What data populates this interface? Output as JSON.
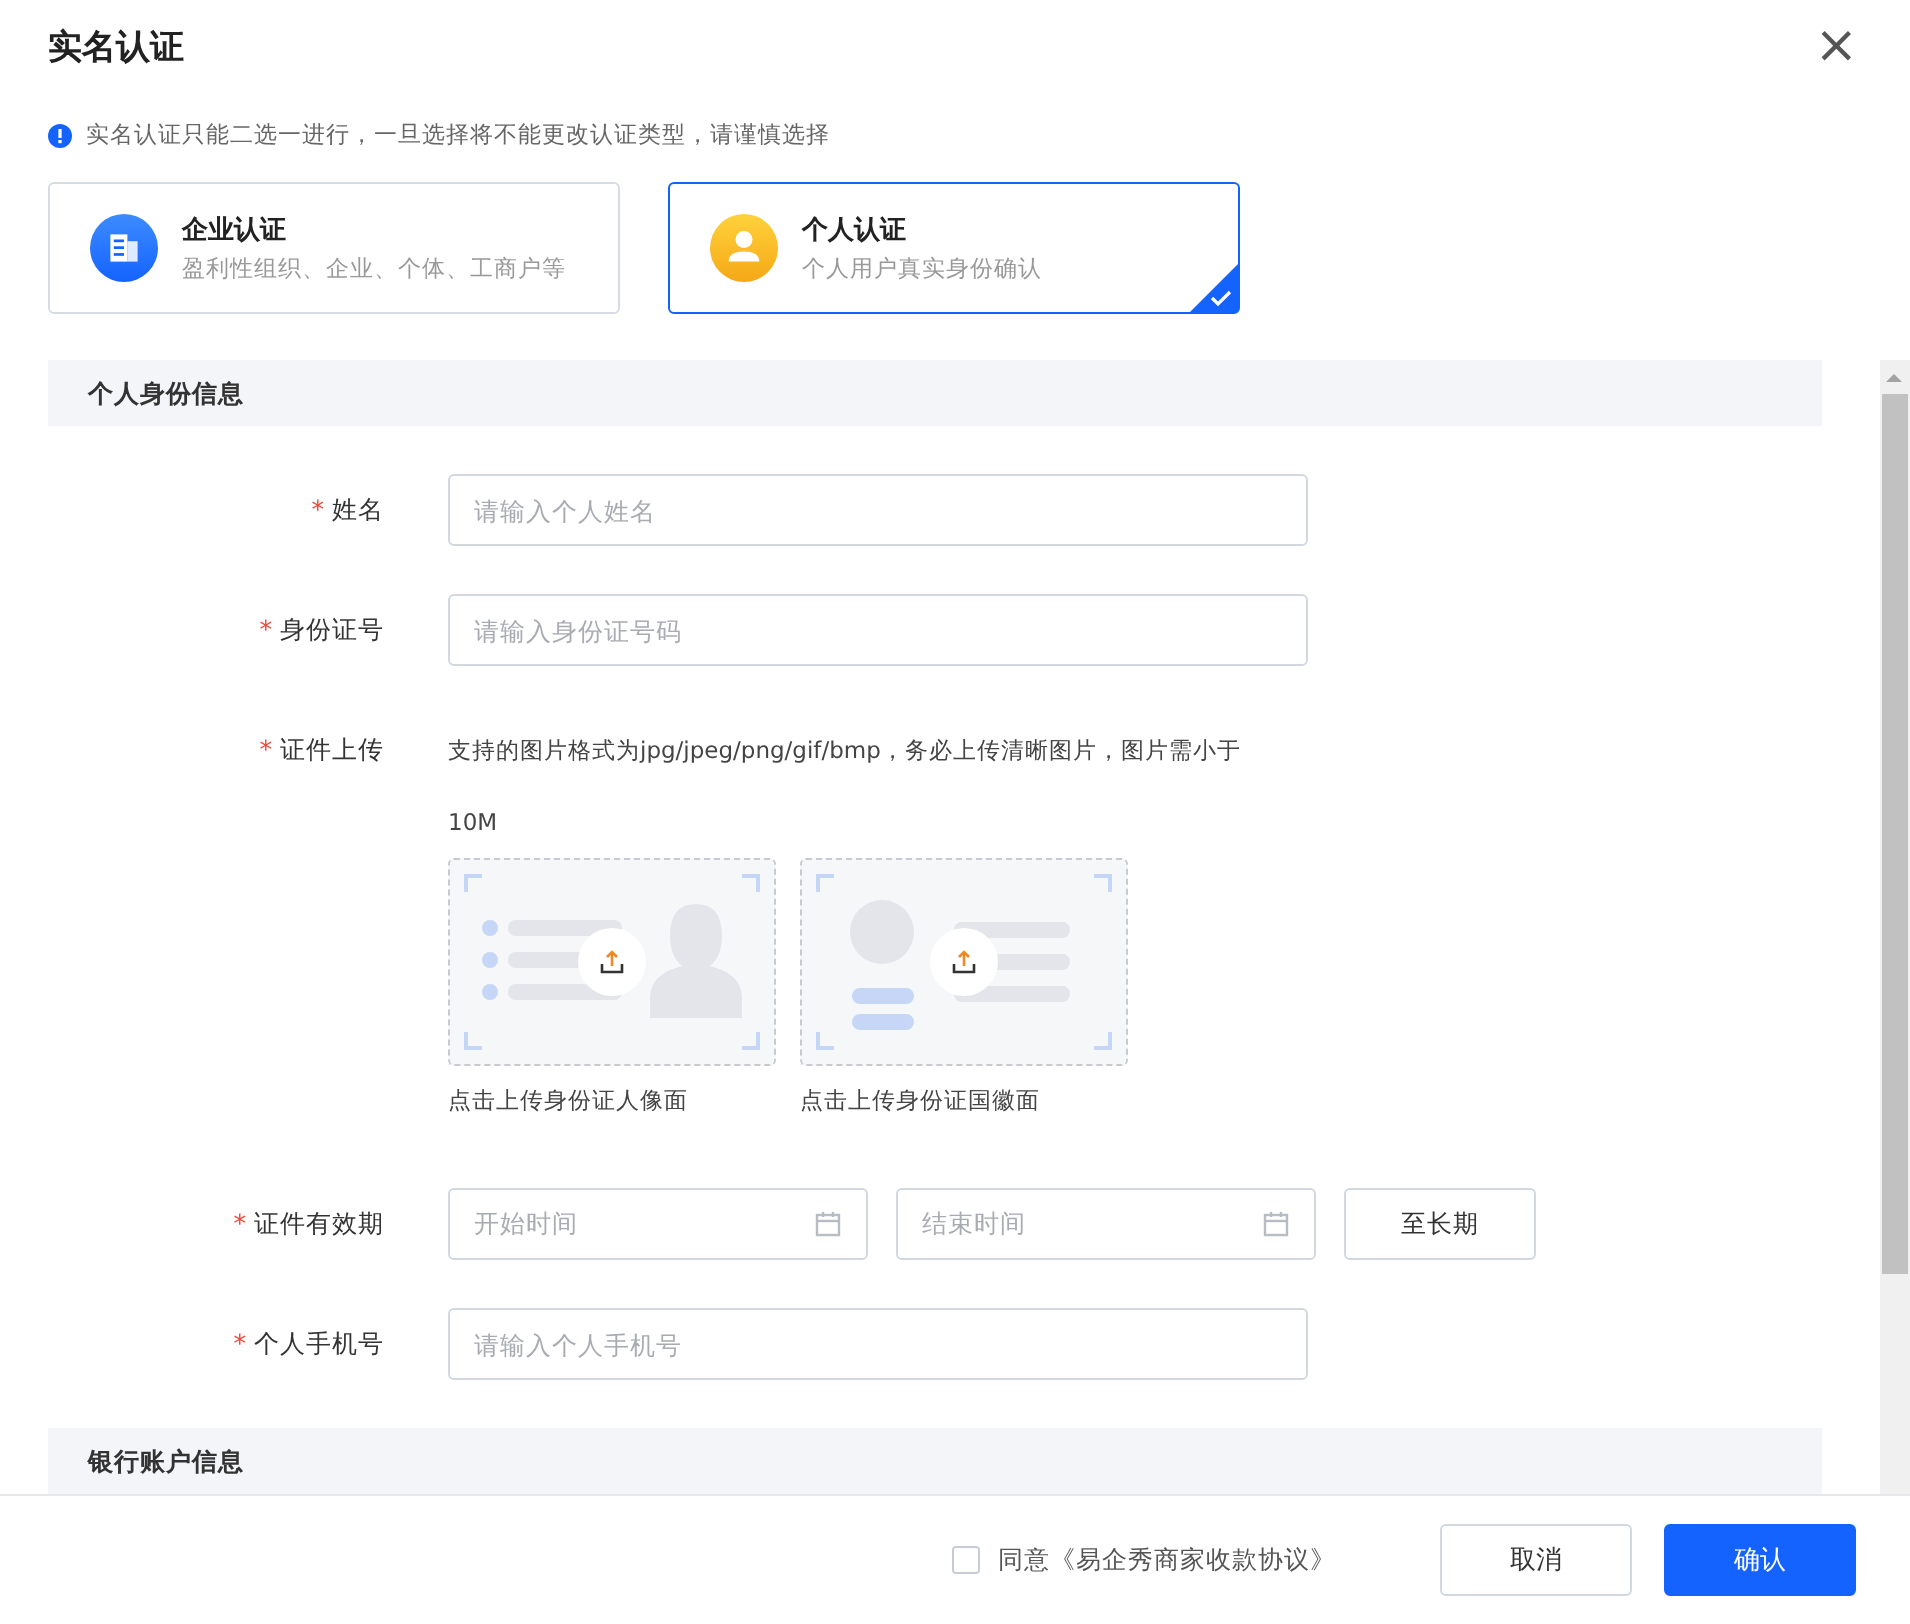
{
  "dialog": {
    "title": "实名认证",
    "close": "×"
  },
  "notice": "实名认证只能二选一进行，一旦选择将不能更改认证类型，请谨慎选择",
  "types": [
    {
      "kind": "company",
      "title": "企业认证",
      "desc": "盈利性组织、企业、个体、工商户等",
      "selected": false
    },
    {
      "kind": "person",
      "title": "个人认证",
      "desc": "个人用户真实身份确认",
      "selected": true
    }
  ],
  "sections": [
    {
      "title": "个人身份信息",
      "fields": [
        {
          "kind": "text",
          "label": "姓名",
          "mark": "*",
          "placeholder": "请输入个人姓名"
        },
        {
          "kind": "text",
          "label": "身份证号",
          "mark": "*",
          "placeholder": "请输入身份证号码"
        },
        {
          "kind": "upload",
          "label": "证件上传",
          "mark": "*",
          "hint": "支持的图片格式为jpg/jpeg/png/gif/bmp，务必上传清晰图片，图片需小于10M",
          "slots": [
            {
              "kind": "portrait",
              "caption": "点击上传身份证人像面"
            },
            {
              "kind": "emblem",
              "caption": "点击上传身份证国徽面"
            }
          ]
        },
        {
          "kind": "daterange",
          "label": "证件有效期",
          "mark": "*",
          "start": "开始时间",
          "end": "结束时间",
          "button": "至长期"
        },
        {
          "kind": "text",
          "label": "个人手机号",
          "mark": "*",
          "placeholder": "请输入个人手机号"
        }
      ]
    },
    {
      "title": "银行账户信息"
    }
  ],
  "footer": {
    "agreement": "同意《易企秀商家收款协议》",
    "agreed": false,
    "cancel": "取消",
    "confirm": "确认"
  }
}
